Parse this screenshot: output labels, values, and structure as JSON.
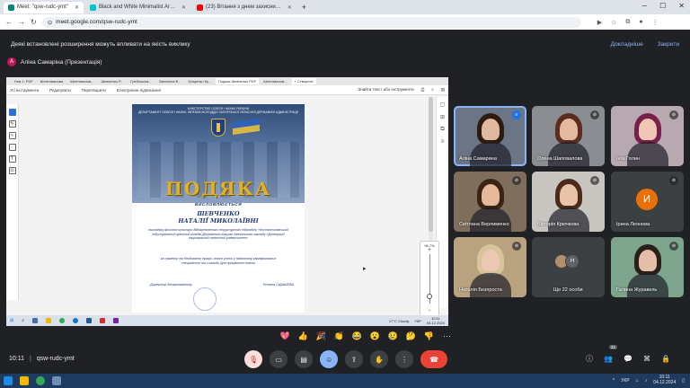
{
  "browser": {
    "tabs": [
      {
        "label": "Meet: \"qsw-rudc-ymt\"",
        "color": "#00897b",
        "active": true
      },
      {
        "label": "Black and White Minimalist Ar…",
        "color": "#00c4cc",
        "active": false
      },
      {
        "label": "(23) Вітання з днем захисни…",
        "color": "#ff0000",
        "active": false
      }
    ],
    "new_tab": "+",
    "url": "meet.google.com/qsw-rudc-ymt"
  },
  "banner": {
    "text": "Деякі встановлені розширення можуть впливати на якість виклику",
    "details": "Докладніше",
    "close": "Закрити"
  },
  "presenter": {
    "initial": "А",
    "name": "Аліна Самаріна (Презентація)"
  },
  "shared_screen": {
    "tabs": [
      "Нов 1: PDF",
      "Шептовалова",
      "Шептовалов...",
      "Шевченко Р...",
      "Гребільник...",
      "Заволоха В...",
      "Гриценко Ку...",
      "Подяка Шевченко PDF",
      "Шептовалов..."
    ],
    "new_tab": "+ Створити",
    "tools": [
      "Усі інструменти",
      "Редагувати",
      "Перетворити",
      "Електронне підписання"
    ],
    "tools_right": "Знайти текст або інструменти",
    "zoom": "96,7%",
    "tray_lang": "УКР",
    "tray_weather": "17°C Cloudy",
    "tray_time": "10:11",
    "tray_date": "04.12.2024"
  },
  "document": {
    "header_line1": "МІНІСТЕРСТВО ОСВІТИ І НАУКИ УКРАЇНИ",
    "header_line2": "ДЕПАРТАМЕНТ ОСВІТИ І НАУКИ, ЗВ'ЯЗКІВ МОЛОДДЮ ЗАПОРІЗЬКОЇ ОБЛАСНОЇ ДЕРЖАВНОЇ АДМІНІСТРАЦІЇ",
    "title": "ПОДЯКА",
    "awarded": "ВИСЛОВЛЮЄТЬСЯ",
    "surname": "ШЕВЧЕНКО",
    "given_names": "НАТАЛІЇ МИКОЛАЇВНІ",
    "body1": "викладачу фізичної культури Відокремленого структурного підрозділу «Костянтинівський індустріальний фаховий коледж Державного вищого навчального закладу «Донецький національний технічний університет»",
    "body2": "за сумлінну та бездоганну працю, значні успіхи у підготовці кваліфікованих спеціалістів та з нагоди Дня працівників освіти",
    "signer_title": "Директор департаменту",
    "signer_name": "Тетяна СІДАШЕВА"
  },
  "participants": [
    {
      "name": "Аліна Самарина",
      "speaking": true,
      "bg": "#6b7586",
      "skin": "#e0b8a0",
      "hair": "#2d1b12"
    },
    {
      "name": "Олена Шаповалова",
      "speaking": false,
      "bg": "#8a8d91",
      "skin": "#e4b9a0",
      "hair": "#5b2c1f"
    },
    {
      "name": "Інга Голин",
      "speaking": false,
      "bg": "#b8a9b0",
      "skin": "#f0c7b5",
      "hair": "#7a1f4a"
    },
    {
      "name": "Світлана Верлименко",
      "speaking": false,
      "bg": "#7f6e5c",
      "skin": "#e7b89a",
      "hair": "#3a2414"
    },
    {
      "name": "Вікторія Крючкова",
      "speaking": false,
      "bg": "#c9c6c1",
      "skin": "#e9c3a7",
      "hair": "#4b2c1c"
    },
    {
      "name": "Ірина Леонова",
      "speaking": false,
      "avatar": "И",
      "avatar_color": "#e8710a"
    },
    {
      "name": "Наталія Безпроста",
      "speaking": false,
      "bg": "#b9a27f",
      "skin": "#ecc8b3",
      "hair": "#d8c49a"
    },
    {
      "name": "Ще 22 особи",
      "speaking": false,
      "extra": true,
      "avatar": "Н"
    },
    {
      "name": "Галина Журавель",
      "speaking": false,
      "bg": "#7da58d",
      "skin": "#e4bea8",
      "hair": "#2b1f1a"
    }
  ],
  "reactions": [
    "💖",
    "👍",
    "🎉",
    "👏",
    "😂",
    "😮",
    "😢",
    "🤔",
    "👎",
    "⋯"
  ],
  "meeting": {
    "time": "10:11",
    "code": "qsw-rudc-ymt",
    "people_count": "21"
  },
  "taskbar": {
    "lang": "УКР",
    "time": "10:11",
    "date": "04.12.2024"
  }
}
